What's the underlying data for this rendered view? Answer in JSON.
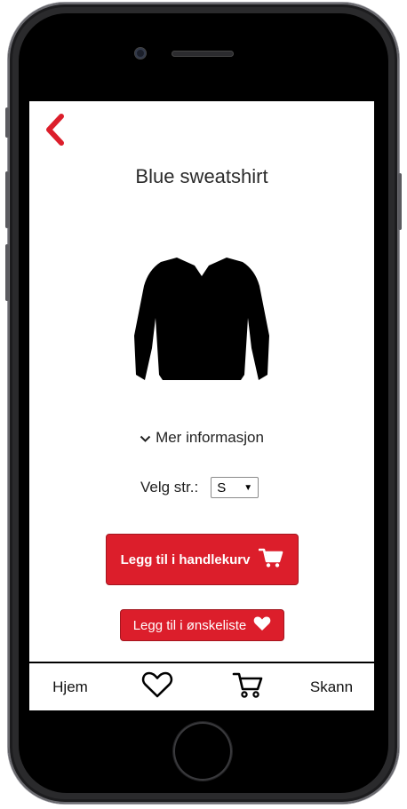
{
  "product": {
    "title": "Blue sweatshirt",
    "image_icon": "sweatshirt-icon"
  },
  "more_info": {
    "label": "Mer informasjon",
    "icon": "chevron-down-icon"
  },
  "size": {
    "label": "Velg str.:",
    "selected": "S",
    "arrow": "▼"
  },
  "actions": {
    "add_to_cart": {
      "label": "Legg til i handlekurv",
      "icon": "cart-icon"
    },
    "add_to_wishlist": {
      "label": "Legg til i ønskeliste",
      "icon": "heart-icon"
    }
  },
  "tabbar": {
    "home": "Hjem",
    "wishlist_icon": "heart-outline-icon",
    "cart_icon": "cart-outline-icon",
    "scan": "Skann"
  },
  "colors": {
    "accent": "#dc1e2b",
    "text": "#222222"
  }
}
